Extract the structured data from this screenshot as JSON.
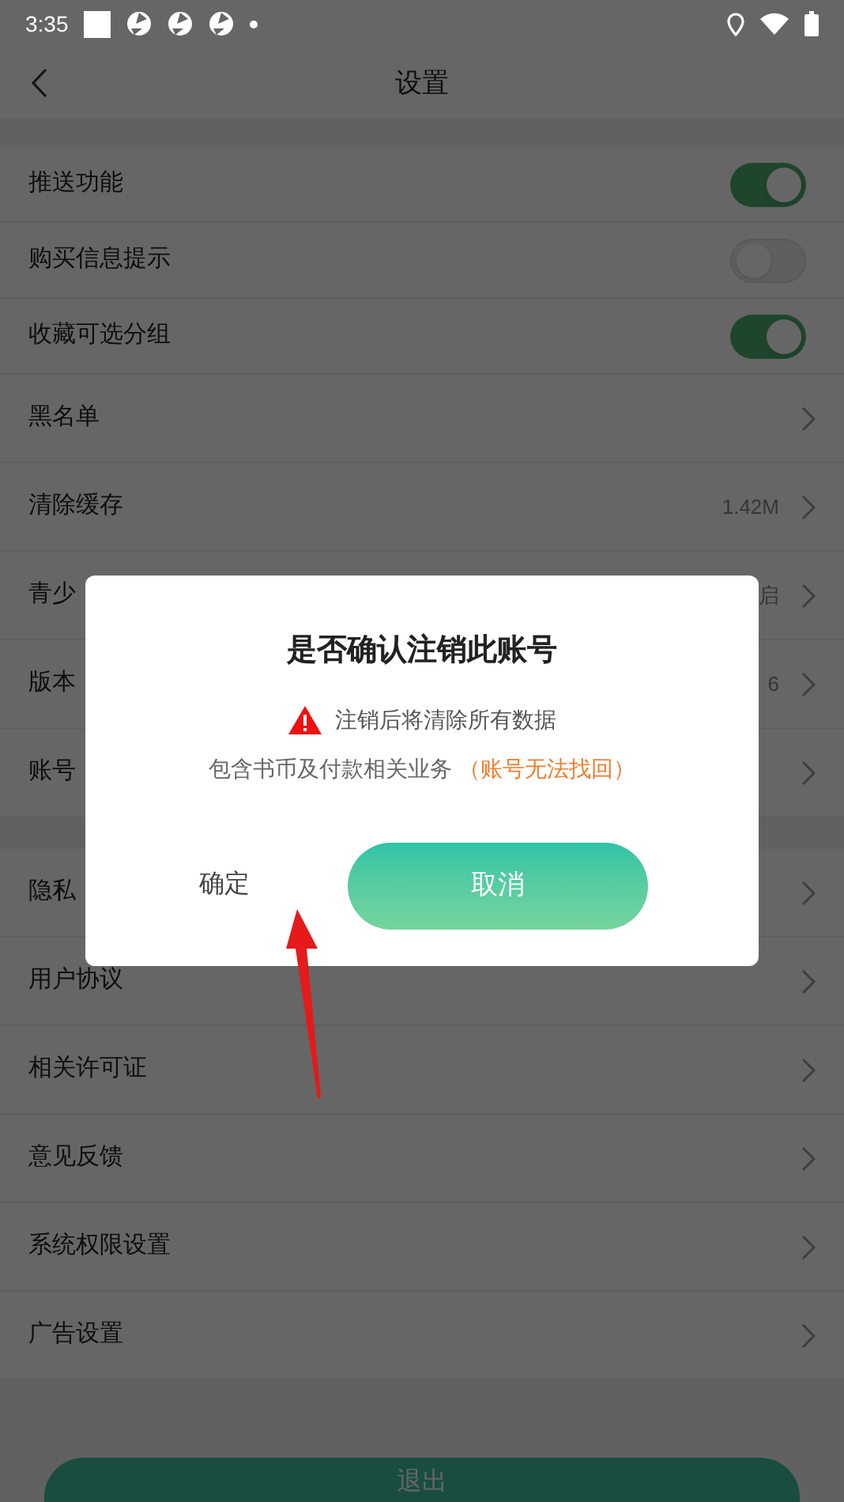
{
  "status_bar": {
    "time": "3:35"
  },
  "header": {
    "title": "设置"
  },
  "groups": [
    [
      {
        "kind": "toggle",
        "label": "推送功能",
        "on": true
      },
      {
        "kind": "toggle",
        "label": "购买信息提示",
        "on": false
      },
      {
        "kind": "toggle",
        "label": "收藏可选分组",
        "on": true
      },
      {
        "kind": "link",
        "label": "黑名单"
      },
      {
        "kind": "link",
        "label": "清除缓存",
        "value": "1.42M"
      },
      {
        "kind": "link",
        "label": "青少",
        "value": "启"
      },
      {
        "kind": "link",
        "label": "版本",
        "value": "6"
      },
      {
        "kind": "link",
        "label": "账号"
      }
    ],
    [
      {
        "kind": "link",
        "label": "隐私"
      },
      {
        "kind": "link",
        "label": "用户协议"
      },
      {
        "kind": "link",
        "label": "相关许可证"
      },
      {
        "kind": "link",
        "label": "意见反馈"
      },
      {
        "kind": "link",
        "label": "系统权限设置"
      },
      {
        "kind": "link",
        "label": "广告设置"
      }
    ]
  ],
  "logout_button": "退出",
  "dialog": {
    "title": "是否确认注销此账号",
    "warning": "注销后将清除所有数据",
    "note": "包含书币及付款相关业务",
    "note_highlight": "（账号无法找回）",
    "confirm": "确定",
    "cancel": "取消"
  }
}
